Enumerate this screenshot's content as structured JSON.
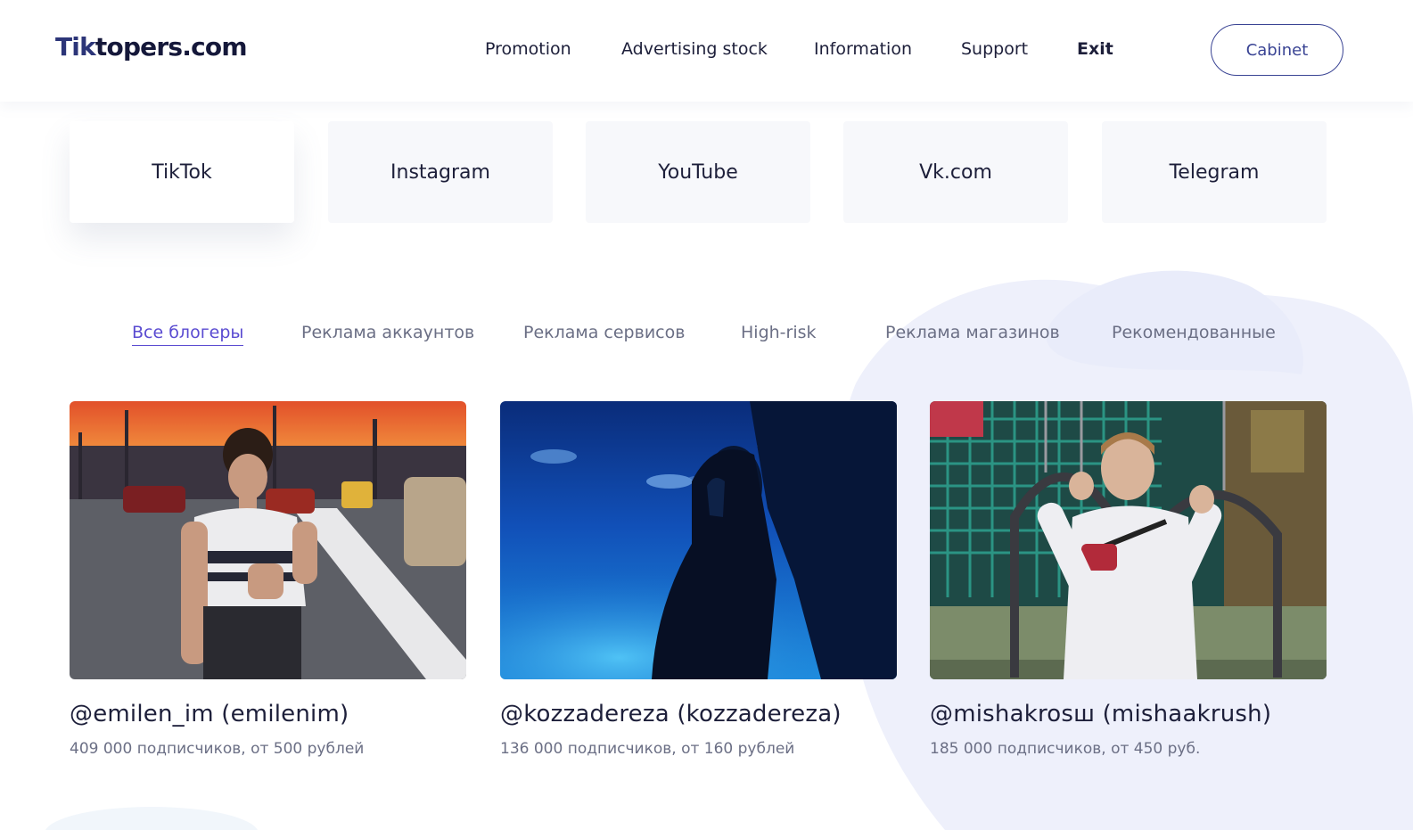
{
  "header": {
    "logo_main": "Tik",
    "logo_rest": "topers.com",
    "nav": [
      {
        "label": "Promotion"
      },
      {
        "label": "Advertising stock"
      },
      {
        "label": "Information"
      },
      {
        "label": "Support"
      },
      {
        "label": "Exit"
      }
    ],
    "cabinet_label": "Cabinet"
  },
  "platforms": [
    {
      "label": "TikTok",
      "active": true
    },
    {
      "label": "Instagram"
    },
    {
      "label": "YouTube"
    },
    {
      "label": "Vk.com"
    },
    {
      "label": "Telegram"
    }
  ],
  "categories": [
    {
      "label": "Все блогеры",
      "active": true
    },
    {
      "label": "Реклама аккаунтов"
    },
    {
      "label": "Реклама сервисов"
    },
    {
      "label": "High-risk"
    },
    {
      "label": "Реклама магазинов"
    },
    {
      "label": "Рекомендованные"
    }
  ],
  "bloggers": [
    {
      "name": "@emilen_im (emilenim)",
      "meta": "409 000 подписчиков, от 500 рублей"
    },
    {
      "name": "@kozzadereza (kozzadereza)",
      "meta": "136 000 подписчиков, от 160 рублей"
    },
    {
      "name": "@mishakrosш (mishaakrush)",
      "meta": "185 000 подписчиков, от 450 руб."
    }
  ],
  "colors": {
    "accent": "#5a4bd1",
    "button_border": "#3a4494",
    "text": "#1d1f3a",
    "muted": "#6b6f85",
    "blob": "#eef0fb"
  }
}
